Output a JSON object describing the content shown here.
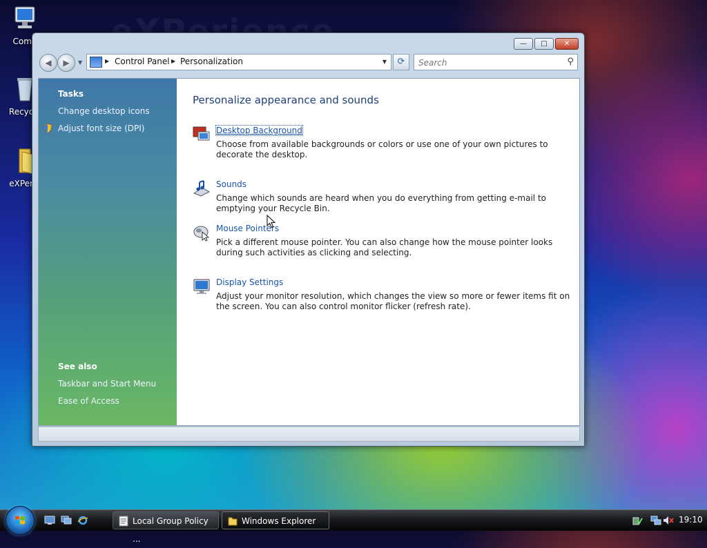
{
  "desktop": {
    "watermark": "eXPerience",
    "icons": [
      {
        "label": "Comp",
        "icon": "computer-icon"
      },
      {
        "label": "Recycle",
        "icon": "recycle-bin-icon"
      },
      {
        "label": "eXPerie",
        "icon": "folder-icon"
      }
    ]
  },
  "window": {
    "controls": {
      "minimize": "—",
      "maximize": "□",
      "close": "✕"
    },
    "breadcrumb": [
      "Control Panel",
      "Personalization"
    ],
    "search_placeholder": "Search"
  },
  "sidebar": {
    "tasks_heading": "Tasks",
    "tasks": [
      {
        "label": "Change desktop icons"
      },
      {
        "label": "Adjust font size (DPI)",
        "icon": "shield-icon"
      }
    ],
    "see_also_heading": "See also",
    "see_also": [
      {
        "label": "Taskbar and Start Menu"
      },
      {
        "label": "Ease of Access"
      }
    ]
  },
  "main": {
    "title": "Personalize appearance and sounds",
    "items": [
      {
        "title": "Desktop Background",
        "icon": "desktop-background-icon",
        "description": "Choose from available backgrounds or colors or use one of your own pictures to decorate the desktop."
      },
      {
        "title": "Sounds",
        "icon": "sounds-icon",
        "description": "Change which sounds are heard when you do everything from getting e-mail to emptying your Recycle Bin."
      },
      {
        "title": "Mouse Pointers",
        "icon": "mouse-icon",
        "description": "Pick a different mouse pointer. You can also change how the mouse pointer looks during such activities as clicking and selecting."
      },
      {
        "title": "Display Settings",
        "icon": "monitor-icon",
        "description": "Adjust your monitor resolution, which changes the view so more or fewer items fit on the screen. You can also control monitor flicker (refresh rate)."
      }
    ]
  },
  "taskbar": {
    "buttons": [
      {
        "label": "Local Group Policy ...",
        "icon": "document-icon"
      },
      {
        "label": "Windows Explorer",
        "icon": "folder-icon"
      }
    ],
    "clock": "19:10"
  }
}
